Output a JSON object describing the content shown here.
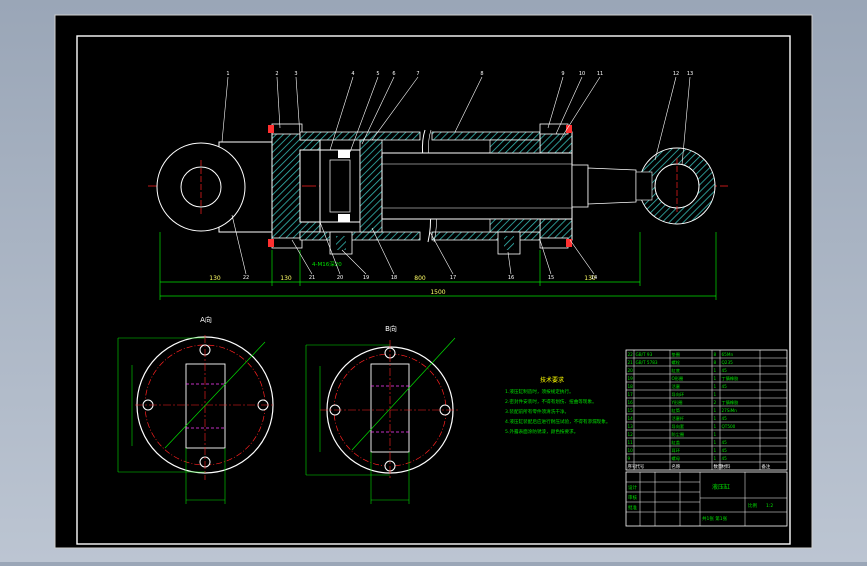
{
  "colors": {
    "background": "#000000",
    "frame": "#ffffff",
    "section_hatch": "#35b7b1",
    "outline": "#ffffff",
    "centerline": "#ff2020",
    "dimension": "#00e000",
    "dimension_text": "#ffff66",
    "hidden": "#ff40ff",
    "balloon_leader": "#ffffff",
    "table_text": "#00e000",
    "notes_heading": "#ffff00",
    "notes_text": "#00e000"
  },
  "views": {
    "view_a_label": "A向",
    "view_b_label": "B向"
  },
  "balloons": {
    "top": [
      "1",
      "2",
      "3",
      "4",
      "5",
      "6",
      "7",
      "8",
      "9",
      "10",
      "11",
      "12",
      "13"
    ],
    "bottom": [
      "22",
      "21",
      "20",
      "19",
      "18",
      "17",
      "16",
      "15",
      "14"
    ]
  },
  "dimensions": {
    "overall_length": "1500",
    "left_clevis": "130",
    "flange_dist": "130",
    "stroke": "800",
    "right_end": "130",
    "flange_note": "4-M16深20"
  },
  "technical_notes": {
    "heading": "技术要求",
    "lines": [
      "1.液压缸制造时，须按规定执行。",
      "2.密封件安装时，不得有划伤、扭曲等现象。",
      "3.装配前所有零件须清洗干净。",
      "4.液压缸装配后应进行耐压试验，不得有渗漏现象。",
      "5.外露表面涂防锈漆，颜色按要求。"
    ]
  },
  "parts_table": {
    "headers": [
      "序号",
      "代号",
      "名称",
      "数量",
      "材料",
      "备注"
    ],
    "rows": [
      [
        "22",
        "GB/T 93",
        "垫圈",
        "8",
        "65Mn",
        ""
      ],
      [
        "21",
        "GB/T 5783",
        "螺栓",
        "8",
        "Q235",
        ""
      ],
      [
        "20",
        "",
        "缸底",
        "1",
        "45",
        ""
      ],
      [
        "19",
        "",
        "O形圈",
        "1",
        "丁腈橡胶",
        ""
      ],
      [
        "18",
        "",
        "活塞",
        "1",
        "45",
        ""
      ],
      [
        "17",
        "",
        "导向环",
        "1",
        "",
        ""
      ],
      [
        "16",
        "",
        "Y形圈",
        "2",
        "丁腈橡胶",
        ""
      ],
      [
        "15",
        "",
        "缸筒",
        "1",
        "27SiMn",
        ""
      ],
      [
        "14",
        "",
        "活塞杆",
        "1",
        "45",
        ""
      ],
      [
        "13",
        "",
        "导向套",
        "1",
        "QT500",
        ""
      ],
      [
        "12",
        "",
        "防尘圈",
        "1",
        "",
        ""
      ],
      [
        "11",
        "",
        "缸盖",
        "1",
        "45",
        ""
      ],
      [
        "10",
        "",
        "耳环",
        "1",
        "45",
        ""
      ],
      [
        "9",
        "",
        "螺母",
        "1",
        "45",
        ""
      ]
    ]
  },
  "title_block": {
    "drawing_title": "液压缸",
    "scale_label": "比例",
    "scale_value": "1:2",
    "sheet": "共1张 第1张",
    "designer_label": "设计",
    "checker_label": "审核",
    "approve_label": "批准"
  }
}
